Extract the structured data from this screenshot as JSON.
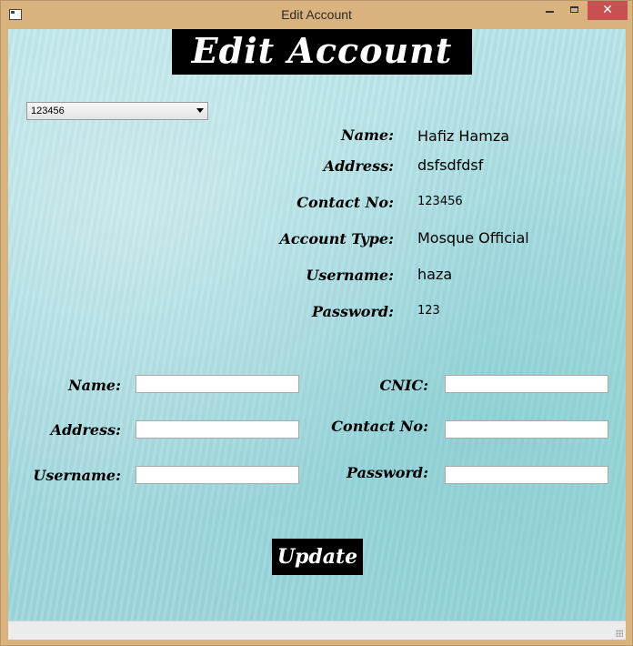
{
  "window": {
    "title": "Edit Account",
    "close_glyph": "✕",
    "icon": "app-window-icon"
  },
  "heading": "Edit Account",
  "account_select": {
    "selected": "123456"
  },
  "details": {
    "name_label": "Name:",
    "name_value": "Hafiz Hamza",
    "address_label": "Address:",
    "address_value": "dsfsdfdsf",
    "contact_label": "Contact No:",
    "contact_value": "123456",
    "account_type_label": "Account Type:",
    "account_type_value": "Mosque Official",
    "username_label": "Username:",
    "username_value": "haza",
    "password_label": "Password:",
    "password_value": "123"
  },
  "form": {
    "name_label": "Name:",
    "name_value": "",
    "cnic_label": "CNIC:",
    "cnic_value": "",
    "address_label": "Address:",
    "address_value": "",
    "contact_label": "Contact No:",
    "contact_value": "",
    "username_label": "Username:",
    "username_value": "",
    "password_label": "Password:",
    "password_value": ""
  },
  "update_label": "Update"
}
